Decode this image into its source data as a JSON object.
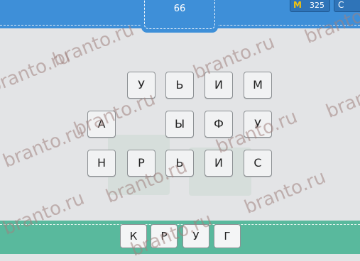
{
  "header": {
    "level_number": "66",
    "coins": "325",
    "coins_icon": "M",
    "menu_glyph": "С"
  },
  "grid": {
    "rows": [
      [
        "У",
        "Ь",
        "И",
        "М"
      ],
      [
        "А",
        "Ы",
        "Ф",
        "У"
      ],
      [
        "Н",
        "Р",
        "Ь",
        "И",
        "С"
      ]
    ]
  },
  "answer": {
    "letters": [
      "К",
      "Р",
      "У",
      "Г"
    ]
  },
  "watermark": "branto.ru",
  "colors": {
    "header_blue": "#3e8fd8",
    "answer_green": "#59b99d",
    "background_gray": "#e3e4e6"
  }
}
